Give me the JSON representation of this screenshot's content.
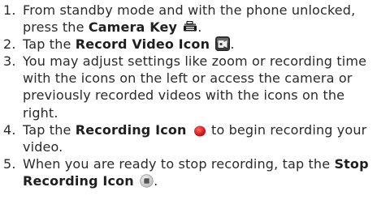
{
  "steps": [
    {
      "number": "1.",
      "pre": "From standby mode and with the phone unlocked, press the ",
      "bold": "Camera Key",
      "icon": "camera-key-icon",
      "post": "."
    },
    {
      "number": "2.",
      "pre": "Tap the ",
      "bold": "Record Video Icon",
      "icon": "record-video-icon",
      "post": "."
    },
    {
      "number": "3.",
      "text": "You may adjust settings like zoom or recording time with the icons on the left or access the camera or previously recorded videos with the icons on the right."
    },
    {
      "number": "4.",
      "pre": "Tap the ",
      "bold": "Recording Icon",
      "icon": "recording-icon",
      "post": " to begin recording your video."
    },
    {
      "number": "5.",
      "pre": "When you are ready to stop recording, tap the ",
      "bold": "Stop Recording Icon",
      "icon": "stop-recording-icon",
      "post": "."
    }
  ],
  "colors": {
    "text": "#2a2a2a",
    "record_red": "#e0262b"
  }
}
